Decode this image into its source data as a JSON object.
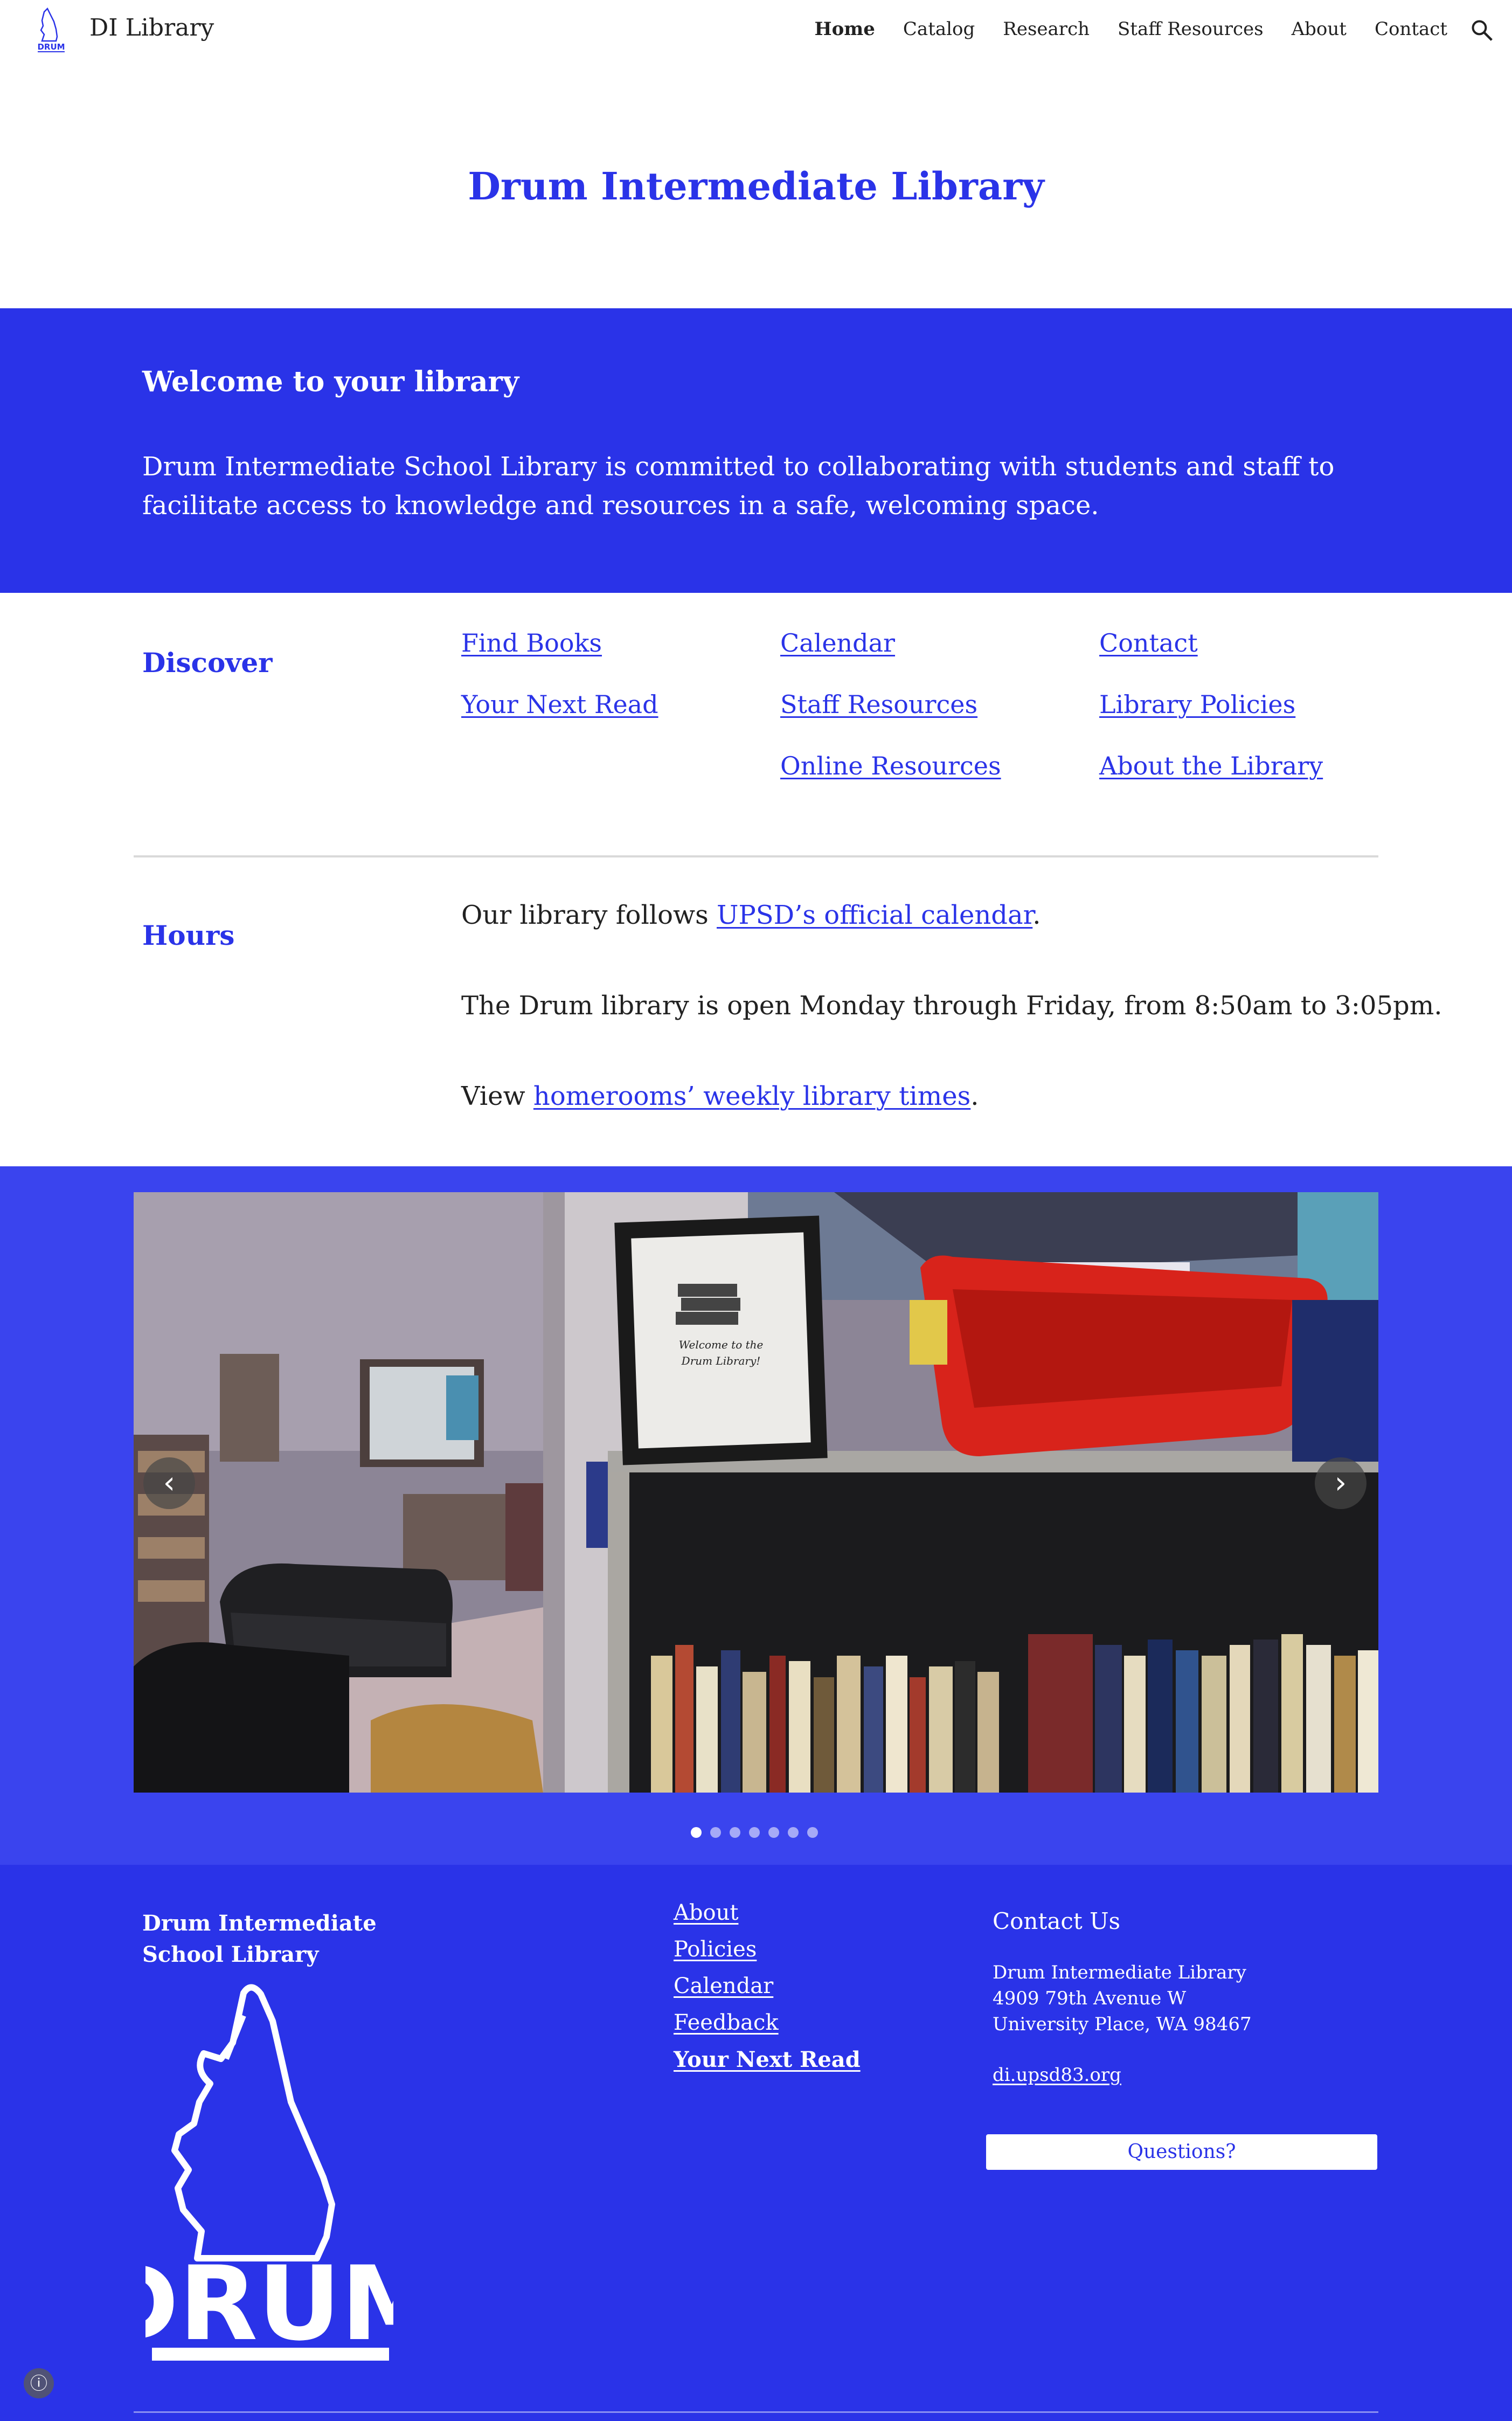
{
  "header": {
    "site_title": "DI Library",
    "nav": [
      {
        "label": "Home",
        "active": true
      },
      {
        "label": "Catalog"
      },
      {
        "label": "Research"
      },
      {
        "label": "Staff Resources"
      },
      {
        "label": "About"
      },
      {
        "label": "Contact"
      }
    ],
    "search_icon": "search-icon"
  },
  "hero": {
    "title": "Drum Intermediate Library"
  },
  "welcome": {
    "heading": "Welcome to your library",
    "body": "Drum Intermediate School Library is committed to collaborating with students and staff to facilitate access to knowledge and resources in a safe, welcoming space."
  },
  "discover": {
    "label": "Discover",
    "links": {
      "find_books": "Find Books",
      "your_next_read": "Your Next Read",
      "calendar": "Calendar",
      "staff_resources": "Staff Resources",
      "online_resources": "Online Resources",
      "contact": "Contact",
      "library_policies": "Library Policies",
      "about_library": "About the Library"
    }
  },
  "hours": {
    "label": "Hours",
    "line1_prefix": "Our library follows ",
    "line1_link": "UPSD’s official calendar",
    "line1_suffix": ".",
    "line2": "The Drum library is open Monday through Friday, from 8:50am to 3:05pm.",
    "line3_prefix": "View ",
    "line3_link": "homerooms’ weekly library times",
    "line3_suffix": "."
  },
  "carousel": {
    "prev": "‹",
    "next": "›",
    "sign_text_1": "Welcome to the",
    "sign_text_2": "Drum Library!",
    "slide_count": 7,
    "active_slide": 1
  },
  "footer": {
    "school_name": "Drum Intermediate School Library",
    "logo_text": "DRUM",
    "links": {
      "about": "About",
      "policies": "Policies",
      "calendar": "Calendar",
      "feedback": "Feedback",
      "your_next_read": "Your Next Read"
    },
    "contact_heading": "Contact Us",
    "address": {
      "line1": "Drum Intermediate Library",
      "line2": "4909 79th Avenue W",
      "line3": "University Place, WA 98467"
    },
    "website": "di.upsd83.org",
    "questions_button": "Questions?"
  },
  "colors": {
    "brand": "#2a33e8",
    "band_alt": "#3a44ee",
    "text": "#212121"
  }
}
